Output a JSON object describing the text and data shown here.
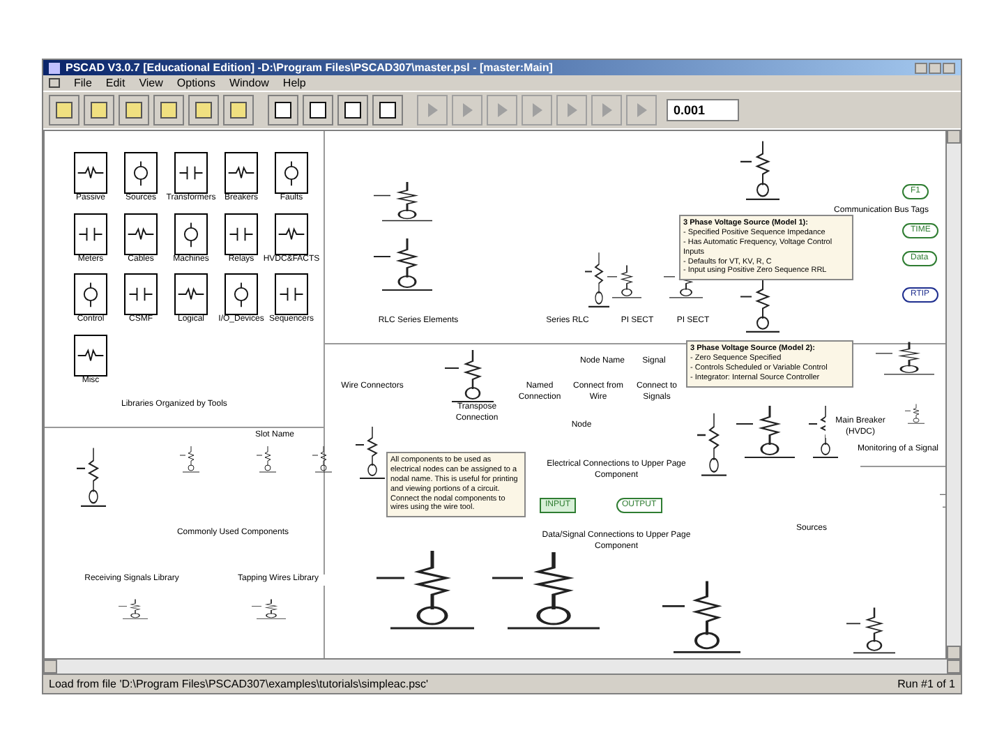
{
  "window": {
    "title": "PSCAD V3.0.7 [Educational Edition] -D:\\Program Files\\PSCAD307\\master.psl - [master:Main]"
  },
  "menu": [
    "File",
    "Edit",
    "View",
    "Options",
    "Window",
    "Help"
  ],
  "toolbar": {
    "time_step": "0.001"
  },
  "library": {
    "tiles": [
      {
        "label": "Passive"
      },
      {
        "label": "Sources"
      },
      {
        "label": "Transformers"
      },
      {
        "label": "Breakers"
      },
      {
        "label": "Faults"
      },
      {
        "label": "Meters"
      },
      {
        "label": "Cables"
      },
      {
        "label": "Machines"
      },
      {
        "label": "Relays"
      },
      {
        "label": "HVDC&FACTS"
      },
      {
        "label": "Control"
      },
      {
        "label": "CSMF"
      },
      {
        "label": "Logical"
      },
      {
        "label": "I/O_Devices"
      },
      {
        "label": "Sequencers"
      },
      {
        "label": "Misc"
      }
    ],
    "caption": "Libraries Organized by Tools"
  },
  "captions": [
    "RLC Series Elements",
    "Series RLC",
    "PI SECT",
    "PI SECT",
    "Communication Bus Tags",
    "Commonly Used Components",
    "Receiving Signals Library",
    "Tapping Wires Library",
    "Wire Connectors",
    "Transpose Connection",
    "Node Name",
    "Signal",
    "Named Connection",
    "Connect from Wire",
    "Connect to Signals",
    "Slot Name",
    "Node",
    "Electrical Connections to Upper Page Component",
    "Data/Signal Connections to Upper Page Component",
    "Main Breaker (HVDC)",
    "Monitoring of a Signal",
    "Sources"
  ],
  "flags": [
    {
      "label": "INPUT",
      "kind": "input"
    },
    {
      "label": "OUTPUT",
      "kind": "output"
    }
  ],
  "tags": [
    {
      "label": "F1",
      "color": "#2f7d32"
    },
    {
      "label": "TIME",
      "color": "#2f7d32"
    },
    {
      "label": "Data",
      "color": "#2f7d32"
    },
    {
      "label": "RTIP",
      "color": "#1f2f8f"
    }
  ],
  "notes": [
    {
      "title": "3 Phase Voltage Source (Model 1):",
      "lines": [
        "- Specified Positive Sequence Impedance",
        "- Has Automatic Frequency, Voltage Control Inputs",
        "- Defaults for VT, KV, R, C",
        "- Input using Positive Zero Sequence RRL"
      ]
    },
    {
      "title": "3 Phase Voltage Source (Model 2):",
      "lines": [
        "- Zero Sequence Specified",
        "- Controls Scheduled or Variable Control",
        "- Integrator: Internal Source Controller"
      ]
    },
    {
      "lines": [
        "All components to be used as electrical nodes can be assigned to a nodal name. This is useful for printing and viewing portions of a circuit. Connect the nodal components to wires using the wire tool."
      ]
    }
  ],
  "status_bar": {
    "message": "Load from file 'D:\\Program Files\\PSCAD307\\examples\\tutorials\\simpleac.psc'",
    "run": "Run #1 of 1"
  }
}
